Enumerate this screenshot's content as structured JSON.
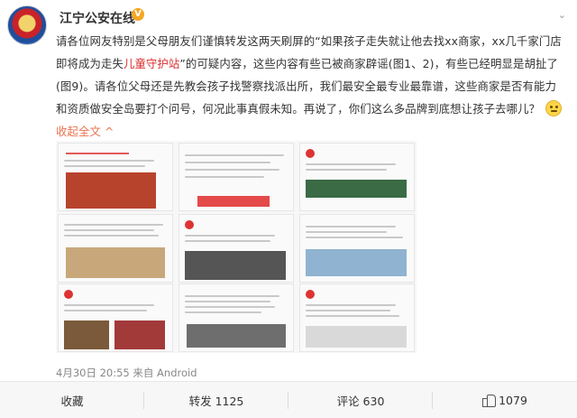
{
  "header": {
    "username": "江宁公安在线",
    "verified_badge": "V",
    "menu_icon": "chevron-down-icon"
  },
  "post": {
    "text_part1": "请各位网友特别是父母朋友们谨慎转发这两天刷屏的“如果孩子走失就让他去找xx商家，xx几千家门店即将成为走失",
    "highlight": "儿童守护站",
    "text_part2": "”的可疑内容，这些内容有些已被商家辟谣(图1、2)，有些已经明显是胡扯了(图9)。请各位父母还是先教会孩子找警察找派出所，我们最安全最专业最靠谱，这些商家是否有能力和资质做安全岛要打个问号，何况此事真假未知。再说了，你们这么多品牌到底想让孩子去哪儿？",
    "collapse_label": "收起全文",
    "collapse_arrow": "^",
    "emoji_icon": "smile-emoji-icon",
    "timestamp": "4月30日 20:55 来自 Android"
  },
  "actions": {
    "favorite": "收藏",
    "repost": "转发 1125",
    "comment": "评论 630",
    "like": "1079"
  }
}
